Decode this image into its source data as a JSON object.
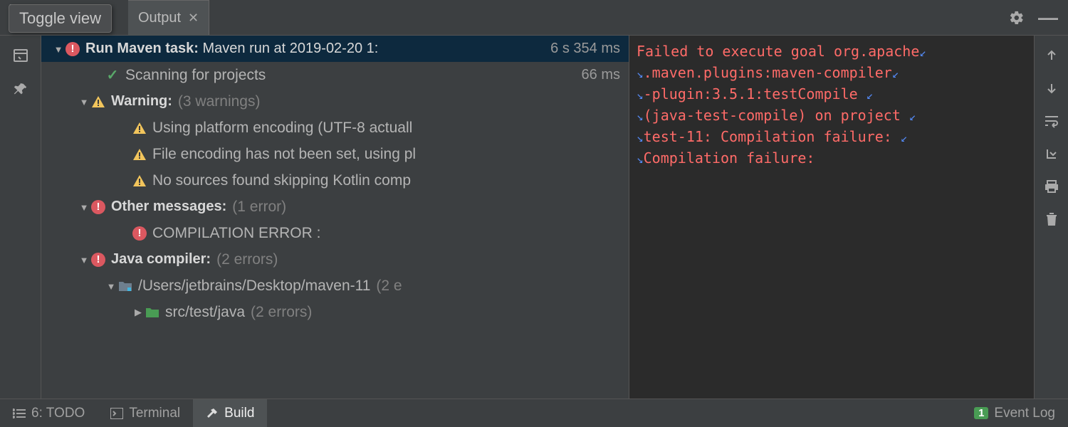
{
  "tooltip": "Toggle view",
  "tab": {
    "label": "Output"
  },
  "tree": {
    "root": {
      "title_prefix": "Run Maven task:",
      "title_detail": "Maven run at 2019-02-20 1:",
      "duration": "6 s 354 ms"
    },
    "scanning": {
      "label": "Scanning for projects",
      "duration": "66 ms"
    },
    "warning": {
      "label": "Warning:",
      "count": "(3 warnings)",
      "items": [
        "Using platform encoding (UTF-8 actuall",
        "File encoding has not been set, using pl",
        "No sources found skipping Kotlin comp"
      ]
    },
    "other": {
      "label": "Other messages:",
      "count": "(1 error)",
      "items": [
        "COMPILATION ERROR :"
      ]
    },
    "compiler": {
      "label": "Java compiler:",
      "count": "(2 errors)",
      "path": "/Users/jetbrains/Desktop/maven-11",
      "path_count": "(2 e",
      "src": "src/test/java",
      "src_count": "(2 errors)"
    }
  },
  "console": {
    "l1": "Failed to execute goal org.apache",
    "l2": ".maven.plugins:maven-compiler",
    "l3": "-plugin:3.5.1:testCompile ",
    "l4": "(java-test-compile) on project ",
    "l5": "test-11: Compilation failure: ",
    "l6": "Compilation failure:"
  },
  "status": {
    "todo": "6: TODO",
    "terminal": "Terminal",
    "build": "Build",
    "event_log": "Event Log",
    "event_badge": "1"
  }
}
